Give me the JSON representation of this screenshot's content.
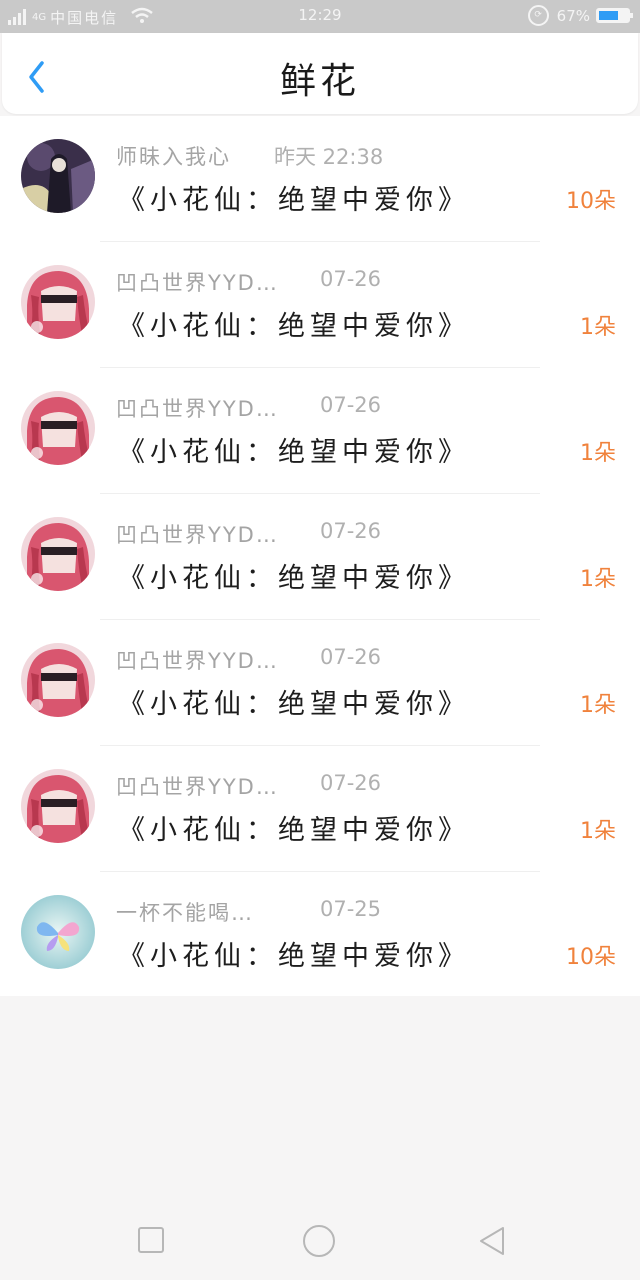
{
  "status_bar": {
    "network": "4G",
    "carrier": "中国电信",
    "time": "12:29",
    "battery": "67%",
    "battery_level": 0.67,
    "battery_color": "#2f9cf5"
  },
  "header": {
    "title": "鲜花",
    "back_icon": "chevron-left-icon",
    "accent_color": "#2f9cf5"
  },
  "flowers": [
    {
      "sender": "师昧入我心",
      "time": "昨天 22:38",
      "gift": "《小花仙：绝望中爱你》",
      "count": "10朵",
      "avatar": "avatar-dark-figure"
    },
    {
      "sender": "凹凸世界YYD…",
      "time": "07-26",
      "gift": "《小花仙：绝望中爱你》",
      "count": "1朵",
      "avatar": "avatar-pink-hair"
    },
    {
      "sender": "凹凸世界YYD…",
      "time": "07-26",
      "gift": "《小花仙：绝望中爱你》",
      "count": "1朵",
      "avatar": "avatar-pink-hair"
    },
    {
      "sender": "凹凸世界YYD…",
      "time": "07-26",
      "gift": "《小花仙：绝望中爱你》",
      "count": "1朵",
      "avatar": "avatar-pink-hair"
    },
    {
      "sender": "凹凸世界YYD…",
      "time": "07-26",
      "gift": "《小花仙：绝望中爱你》",
      "count": "1朵",
      "avatar": "avatar-pink-hair"
    },
    {
      "sender": "凹凸世界YYD…",
      "time": "07-26",
      "gift": "《小花仙：绝望中爱你》",
      "count": "1朵",
      "avatar": "avatar-pink-hair"
    },
    {
      "sender": "一杯不能喝…",
      "time": "07-25",
      "gift": "《小花仙：绝望中爱你》",
      "count": "10朵",
      "avatar": "avatar-butterfly"
    }
  ],
  "count_color": "#f0823c",
  "nav": {
    "recent_icon": "square-icon",
    "home_icon": "circle-icon",
    "back_icon": "triangle-back-icon"
  }
}
